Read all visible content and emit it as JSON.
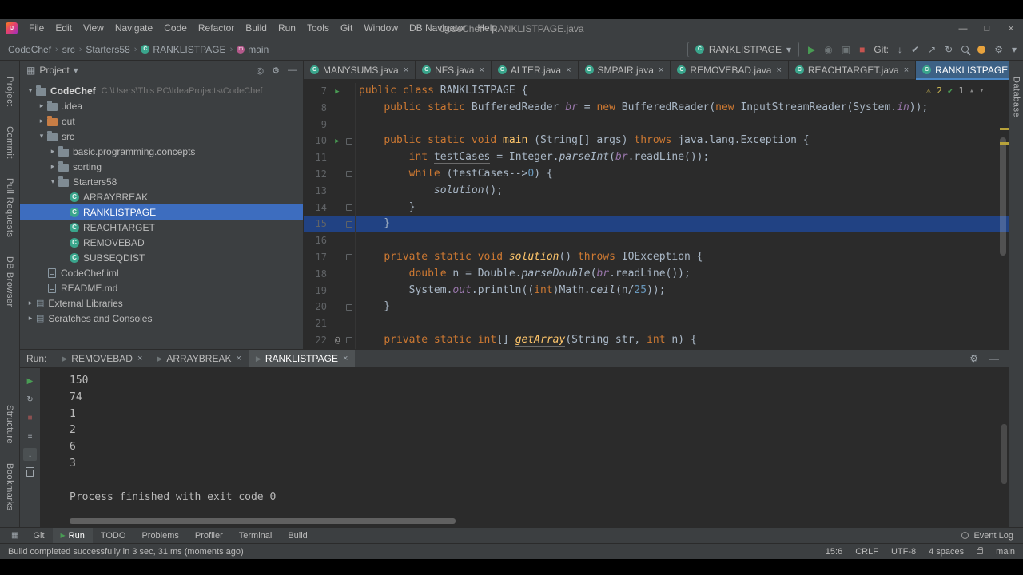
{
  "window": {
    "title": "CodeChef - RANKLISTPAGE.java"
  },
  "menubar": [
    "File",
    "Edit",
    "View",
    "Navigate",
    "Code",
    "Refactor",
    "Build",
    "Run",
    "Tools",
    "Git",
    "Window",
    "DB Navigator",
    "Help"
  ],
  "breadcrumbs": [
    {
      "label": "CodeChef"
    },
    {
      "label": "src"
    },
    {
      "label": "Starters58"
    },
    {
      "label": "RANKLISTPAGE",
      "icon": "class"
    },
    {
      "label": "main",
      "icon": "method"
    }
  ],
  "toolbar": {
    "run_config": "RANKLISTPAGE",
    "git_label": "Git:"
  },
  "left_strip_top": [
    "Project",
    "Commit",
    "Pull Requests",
    "DB Browser"
  ],
  "left_strip_bottom": [
    "Structure",
    "Bookmarks"
  ],
  "right_strip": [
    "Database"
  ],
  "project": {
    "header": "Project",
    "tree": [
      {
        "label": "CodeChef",
        "hint": "C:\\Users\\This PC\\IdeaProjects\\CodeChef",
        "depth": 0,
        "icon": "folder",
        "arrow": "open",
        "bold": true
      },
      {
        "label": ".idea",
        "depth": 1,
        "icon": "folder",
        "arrow": "closed"
      },
      {
        "label": "out",
        "depth": 1,
        "icon": "folder",
        "arrow": "closed",
        "excluded": true
      },
      {
        "label": "src",
        "depth": 1,
        "icon": "folder-src",
        "arrow": "open"
      },
      {
        "label": "basic.programming.concepts",
        "depth": 2,
        "icon": "folder",
        "arrow": "closed"
      },
      {
        "label": "sorting",
        "depth": 2,
        "icon": "folder",
        "arrow": "closed"
      },
      {
        "label": "Starters58",
        "depth": 2,
        "icon": "folder",
        "arrow": "open"
      },
      {
        "label": "ARRAYBREAK",
        "depth": 3,
        "icon": "class"
      },
      {
        "label": "RANKLISTPAGE",
        "depth": 3,
        "icon": "class",
        "selected": true
      },
      {
        "label": "REACHTARGET",
        "depth": 3,
        "icon": "class"
      },
      {
        "label": "REMOVEBAD",
        "depth": 3,
        "icon": "class"
      },
      {
        "label": "SUBSEQDIST",
        "depth": 3,
        "icon": "class"
      },
      {
        "label": "CodeChef.iml",
        "depth": 1,
        "icon": "file"
      },
      {
        "label": "README.md",
        "depth": 1,
        "icon": "file"
      },
      {
        "label": "External Libraries",
        "depth": 0,
        "icon": "lib",
        "arrow": "closed"
      },
      {
        "label": "Scratches and Consoles",
        "depth": 0,
        "icon": "scratch",
        "arrow": "closed"
      }
    ]
  },
  "editor": {
    "tabs": [
      {
        "label": "MANYSUMS.java"
      },
      {
        "label": "NFS.java"
      },
      {
        "label": "ALTER.java"
      },
      {
        "label": "SMPAIR.java"
      },
      {
        "label": "REMOVEBAD.java"
      },
      {
        "label": "REACHTARGET.java"
      },
      {
        "label": "RANKLISTPAGE.java",
        "active": true
      }
    ],
    "inspections": {
      "warnings": "2",
      "ok": "1"
    },
    "lines": [
      {
        "n": "7",
        "g": "run",
        "seg": [
          [
            "k",
            "public class "
          ],
          [
            "p",
            "RANKLISTPAGE {"
          ]
        ]
      },
      {
        "n": "8",
        "seg": [
          [
            "p",
            "    "
          ],
          [
            "k",
            "public static "
          ],
          [
            "p",
            "BufferedReader "
          ],
          [
            "fld",
            "br"
          ],
          [
            "p",
            " = "
          ],
          [
            "k",
            "new "
          ],
          [
            "p",
            "BufferedReader("
          ],
          [
            "k",
            "new "
          ],
          [
            "p",
            "InputStreamReader(System."
          ],
          [
            "fld",
            "in"
          ],
          [
            "p",
            "));"
          ]
        ]
      },
      {
        "n": "9",
        "seg": []
      },
      {
        "n": "10",
        "g": "run",
        "fold": "s",
        "seg": [
          [
            "p",
            "    "
          ],
          [
            "k",
            "public static void "
          ],
          [
            "f",
            "main"
          ],
          [
            "p",
            " (String[] args) "
          ],
          [
            "k",
            "throws "
          ],
          [
            "p",
            "java.lang.Exception {"
          ]
        ]
      },
      {
        "n": "11",
        "seg": [
          [
            "p",
            "        "
          ],
          [
            "k",
            "int "
          ],
          [
            "u",
            "testCases"
          ],
          [
            "p",
            " = Integer."
          ],
          [
            "m",
            "parseInt"
          ],
          [
            "p",
            "("
          ],
          [
            "fld",
            "br"
          ],
          [
            "p",
            ".readLine());"
          ]
        ]
      },
      {
        "n": "12",
        "fold": "s",
        "seg": [
          [
            "p",
            "        "
          ],
          [
            "k",
            "while "
          ],
          [
            "p",
            "("
          ],
          [
            "u",
            "testCases"
          ],
          [
            "p",
            "-->"
          ],
          [
            "num",
            "0"
          ],
          [
            "p",
            ") {"
          ]
        ]
      },
      {
        "n": "13",
        "seg": [
          [
            "p",
            "            "
          ],
          [
            "m",
            "solution"
          ],
          [
            "p",
            "();"
          ]
        ]
      },
      {
        "n": "14",
        "fold": "e",
        "seg": [
          [
            "p",
            "        }"
          ]
        ]
      },
      {
        "n": "15",
        "cur": true,
        "fold": "e",
        "seg": [
          [
            "p",
            "    }"
          ]
        ]
      },
      {
        "n": "16",
        "seg": []
      },
      {
        "n": "17",
        "fold": "s",
        "seg": [
          [
            "p",
            "    "
          ],
          [
            "k",
            "private static void "
          ],
          [
            "fi",
            "solution"
          ],
          [
            "p",
            "() "
          ],
          [
            "k",
            "throws "
          ],
          [
            "p",
            "IOException {"
          ]
        ]
      },
      {
        "n": "18",
        "seg": [
          [
            "p",
            "        "
          ],
          [
            "k",
            "double "
          ],
          [
            "p",
            "n = Double."
          ],
          [
            "m",
            "parseDouble"
          ],
          [
            "p",
            "("
          ],
          [
            "fld",
            "br"
          ],
          [
            "p",
            ".readLine());"
          ]
        ]
      },
      {
        "n": "19",
        "seg": [
          [
            "p",
            "        System."
          ],
          [
            "fld",
            "out"
          ],
          [
            "p",
            ".println(("
          ],
          [
            "k",
            "int"
          ],
          [
            "p",
            ")Math."
          ],
          [
            "m",
            "ceil"
          ],
          [
            "p",
            "(n/"
          ],
          [
            "num",
            "25"
          ],
          [
            "p",
            "));"
          ]
        ]
      },
      {
        "n": "20",
        "fold": "e",
        "seg": [
          [
            "p",
            "    }"
          ]
        ]
      },
      {
        "n": "21",
        "seg": []
      },
      {
        "n": "22",
        "g": "at",
        "fold": "s",
        "seg": [
          [
            "p",
            "    "
          ],
          [
            "k",
            "private static int"
          ],
          [
            "p",
            "[] "
          ],
          [
            "fu",
            "getArray"
          ],
          [
            "p",
            "(String str, "
          ],
          [
            "k",
            "int"
          ],
          [
            "p",
            " n) {"
          ]
        ]
      }
    ]
  },
  "run": {
    "label": "Run:",
    "tabs": [
      {
        "label": "REMOVEBAD"
      },
      {
        "label": "ARRAYBREAK"
      },
      {
        "label": "RANKLISTPAGE",
        "active": true
      }
    ],
    "output": [
      "150",
      "74",
      "1",
      "2",
      "6",
      "3",
      "",
      "Process finished with exit code 0"
    ]
  },
  "bottombar": {
    "left": [
      "Git",
      "Run",
      "TODO",
      "Problems",
      "Profiler",
      "Terminal",
      "Build"
    ],
    "active": "Run",
    "event_log": "Event Log"
  },
  "statusbar": {
    "message": "Build completed successfully in 3 sec, 31 ms (moments ago)",
    "caret": "15:6",
    "line_sep": "CRLF",
    "encoding": "UTF-8",
    "indent": "4 spaces",
    "branch": "main"
  },
  "colors": {
    "accent_blue": "#3d6dbf",
    "keyword_orange": "#cc7832",
    "class_icon_teal": "#3aa58c",
    "run_green": "#499c54",
    "stop_red": "#c75450"
  },
  "icons": {
    "logo_text": "IJ",
    "run_play": "▶",
    "stop": "■",
    "commit_check": "✔",
    "update_down": "↓",
    "push_up": "↗",
    "rotate": "↻",
    "gear": "⚙",
    "chevron_down": "▾",
    "chevron_right": "▸",
    "chevron_up_small": "▴",
    "crumb_sep": "›",
    "minimize": "—",
    "maximize": "□",
    "close": "×",
    "warning": "⚠",
    "menu_lines": "≡",
    "at_sign": "@",
    "locate": "◎",
    "hide": "—",
    "lib": "▤",
    "grid": "▦",
    "dim_a": "◉",
    "dim_b": "▣",
    "scroll_down": "↓"
  }
}
